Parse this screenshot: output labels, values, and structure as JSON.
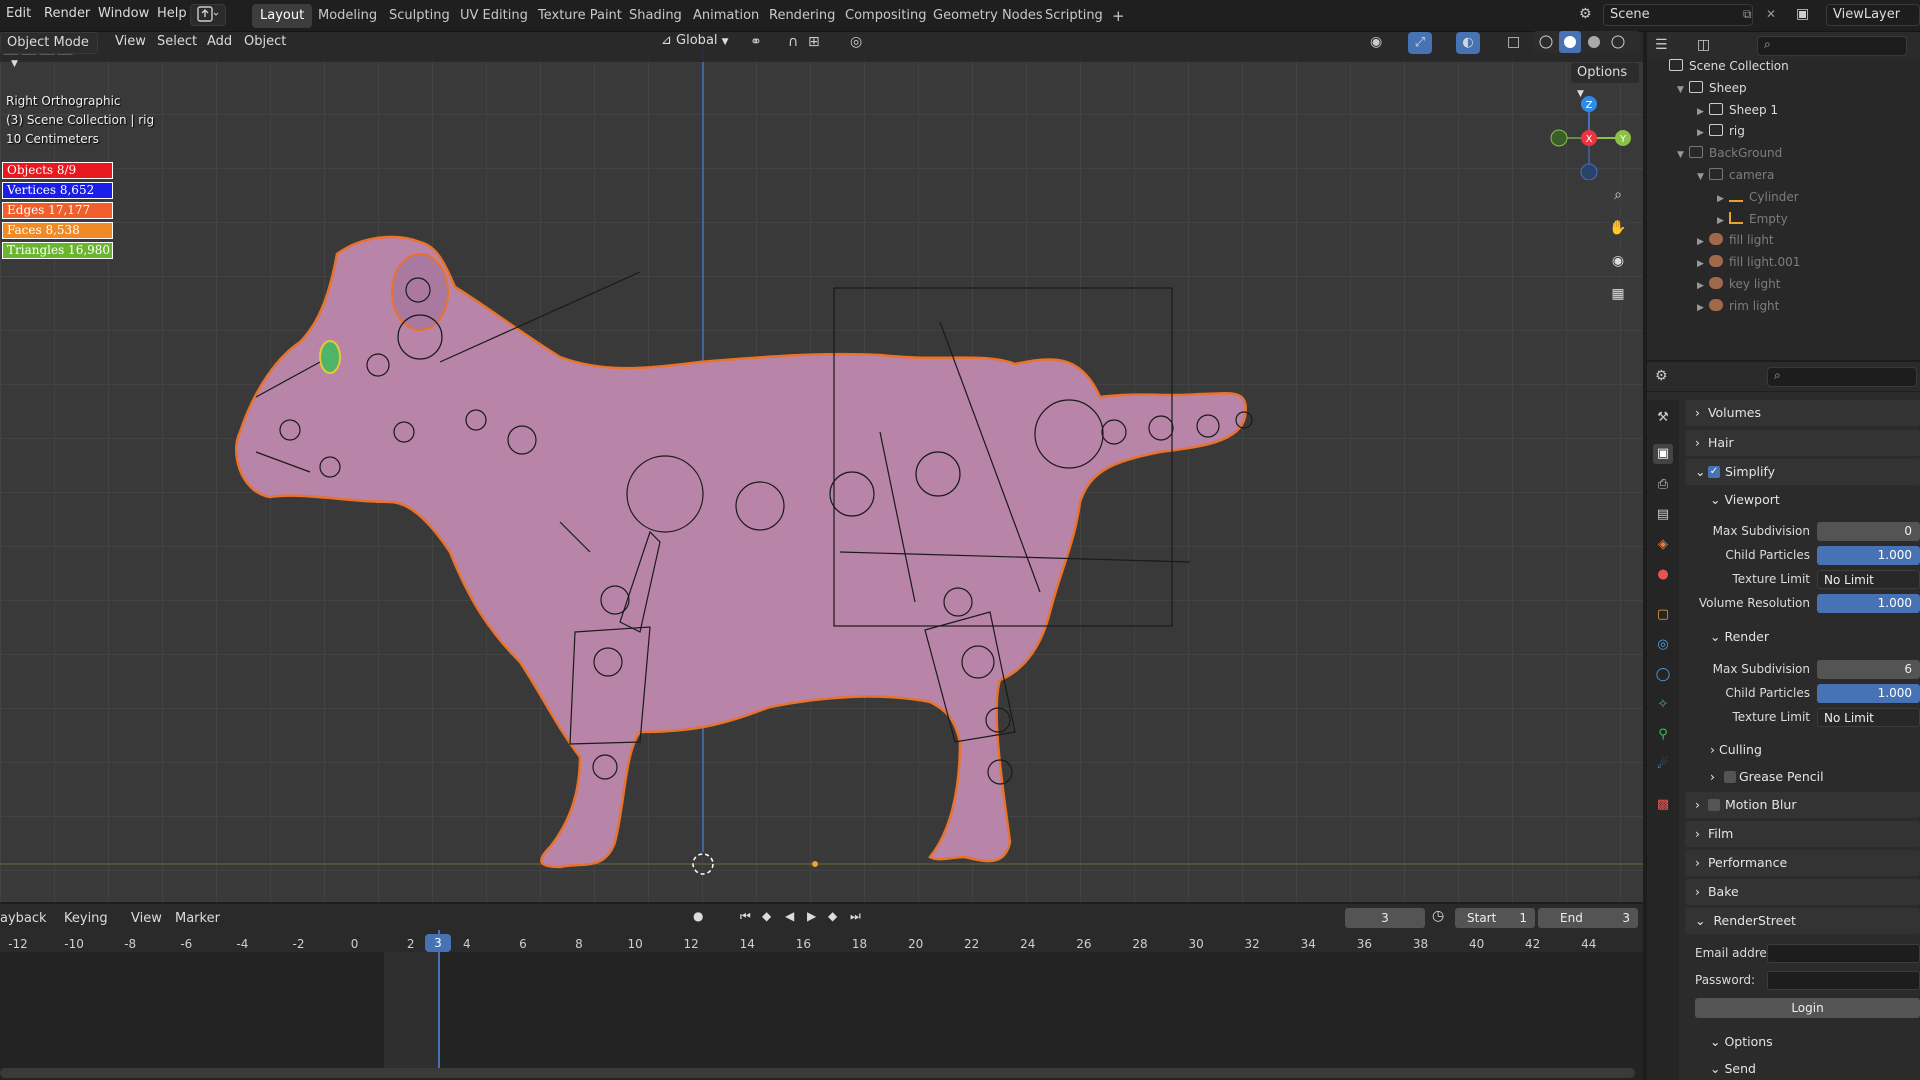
{
  "topbar": {
    "menus": [
      "Edit",
      "Render",
      "Window",
      "Help"
    ],
    "workspaces": [
      "Layout",
      "Modeling",
      "Sculpting",
      "UV Editing",
      "Texture Paint",
      "Shading",
      "Animation",
      "Rendering",
      "Compositing",
      "Geometry Nodes",
      "Scripting"
    ],
    "add_tab": "+",
    "scene": "Scene",
    "view_layer": "ViewLayer"
  },
  "viewport_header": {
    "mode": "Object Mode",
    "menus": [
      "View",
      "Select",
      "Add",
      "Object"
    ],
    "orientation": "Global",
    "options": "Options"
  },
  "viewport_overlay": {
    "view_name": "Right Orthographic",
    "collection": "(3) Scene Collection | rig",
    "scale": "10 Centimeters",
    "stats": [
      {
        "label": "Objects 8/9",
        "color": "#e8191e"
      },
      {
        "label": "Vertices 8,652",
        "color": "#1a1ee6"
      },
      {
        "label": "Edges 17,177",
        "color": "#ef5e2b"
      },
      {
        "label": "Faces 8,538",
        "color": "#f08a27"
      },
      {
        "label": "Triangles 16,980",
        "color": "#6ab52f"
      }
    ],
    "gizmo_axes": {
      "z": "Z",
      "x": "X",
      "y": "Y"
    }
  },
  "outliner": {
    "items": [
      {
        "label": "Scene Collection",
        "indent": 0,
        "dim": false
      },
      {
        "label": "Sheep",
        "indent": 1,
        "dim": false
      },
      {
        "label": "Sheep 1",
        "indent": 2,
        "dim": false
      },
      {
        "label": "rig",
        "indent": 2,
        "dim": false
      },
      {
        "label": "BackGround",
        "indent": 1,
        "dim": true
      },
      {
        "label": "camera",
        "indent": 2,
        "dim": true
      },
      {
        "label": "Cylinder",
        "indent": 3,
        "dim": true
      },
      {
        "label": "Empty",
        "indent": 3,
        "dim": true
      },
      {
        "label": "fill light",
        "indent": 2,
        "dim": true
      },
      {
        "label": "fill light.001",
        "indent": 2,
        "dim": true
      },
      {
        "label": "key light",
        "indent": 2,
        "dim": true
      },
      {
        "label": "rim light",
        "indent": 2,
        "dim": true
      }
    ]
  },
  "properties": {
    "volumes": "Volumes",
    "hair": "Hair",
    "simplify": "Simplify",
    "simplify_checked": true,
    "viewport": "Viewport",
    "vp_max_subdivision_label": "Max Subdivision",
    "vp_max_subdivision": "0",
    "vp_child_particles_label": "Child Particles",
    "vp_child_particles": "1.000",
    "vp_texture_limit_label": "Texture Limit",
    "vp_texture_limit": "No Limit",
    "vp_volume_resolution_label": "Volume Resolution",
    "vp_volume_resolution": "1.000",
    "render": "Render",
    "r_max_subdivision_label": "Max Subdivision",
    "r_max_subdivision": "6",
    "r_child_particles_label": "Child Particles",
    "r_child_particles": "1.000",
    "r_texture_limit_label": "Texture Limit",
    "r_texture_limit": "No Limit",
    "culling": "Culling",
    "grease_pencil": "Grease Pencil",
    "motion_blur": "Motion Blur",
    "film": "Film",
    "performance": "Performance",
    "bake": "Bake",
    "renderstreet": "RenderStreet",
    "email_label": "Email addre...",
    "password_label": "Password:",
    "login": "Login",
    "options": "Options",
    "send": "Send"
  },
  "timeline": {
    "menus": [
      "ayback",
      "Keying",
      "View",
      "Marker"
    ],
    "current_frame": "3",
    "start_label": "Start",
    "start": "1",
    "end_label": "End",
    "end": "3",
    "frame_labels": [
      "-12",
      "-10",
      "-8",
      "-6",
      "-4",
      "-2",
      "0",
      "2",
      "4",
      "6",
      "8",
      "10",
      "12",
      "14",
      "16",
      "18",
      "20",
      "22",
      "24",
      "26",
      "28",
      "30",
      "32",
      "34",
      "36",
      "38",
      "40",
      "42",
      "44"
    ]
  }
}
